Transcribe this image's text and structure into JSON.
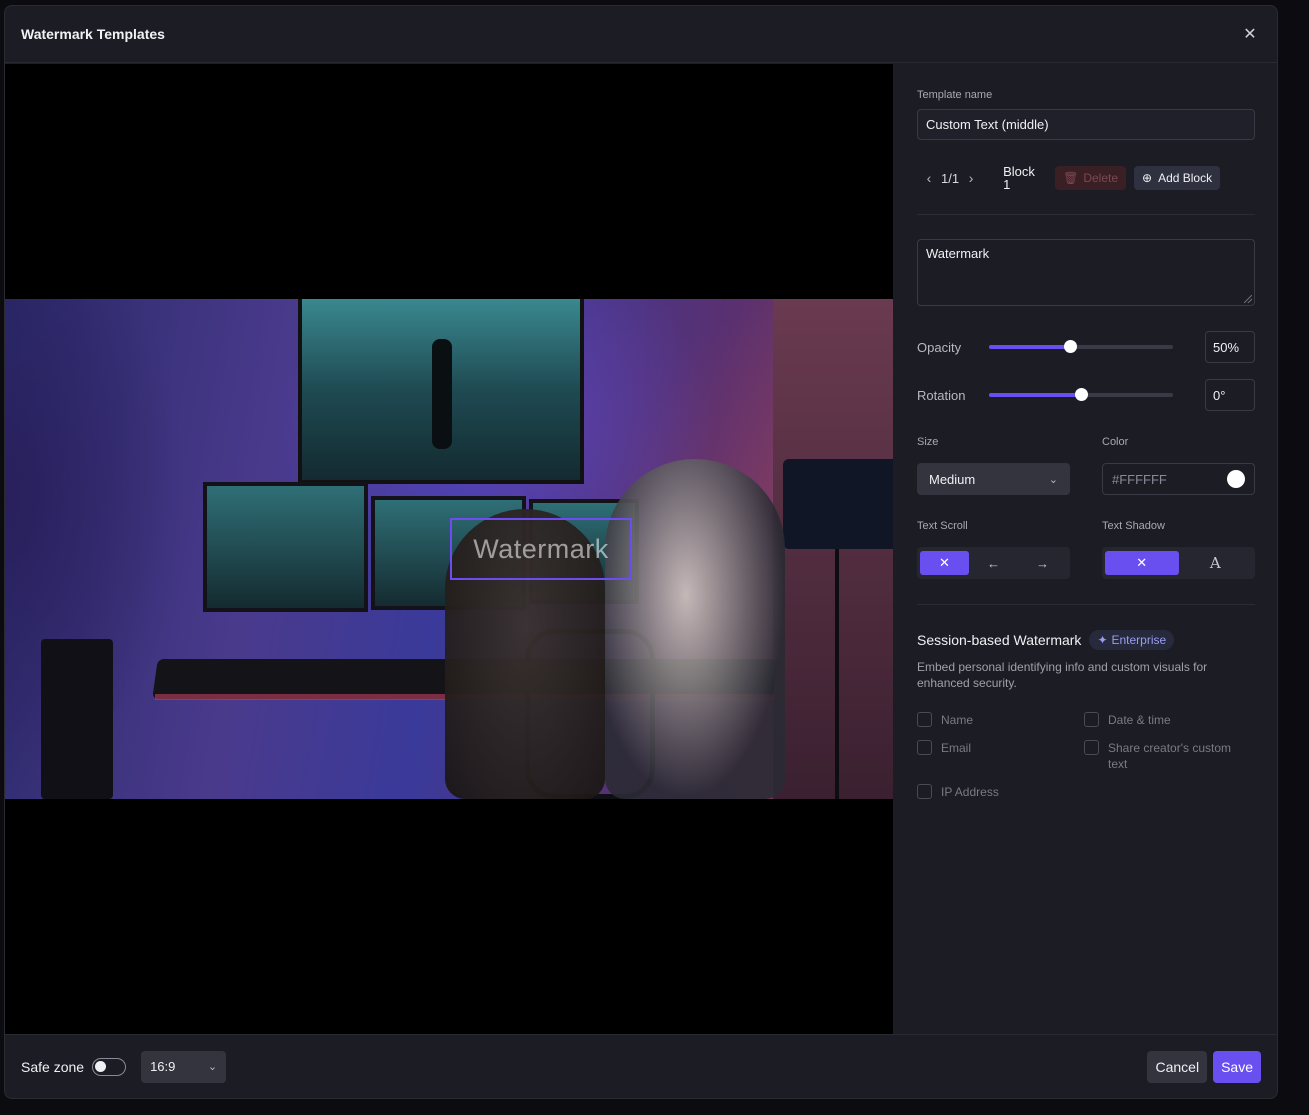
{
  "modal": {
    "title": "Watermark Templates"
  },
  "preview": {
    "watermark_text": "Watermark"
  },
  "settings": {
    "template_name_label": "Template name",
    "template_name_value": "Custom Text (middle)",
    "pager": "1/1",
    "block_label": "Block 1",
    "delete_label": "Delete",
    "add_block_label": "Add Block",
    "watermark_text": "Watermark",
    "opacity": {
      "label": "Opacity",
      "value": "50%",
      "fraction": 0.5
    },
    "rotation": {
      "label": "Rotation",
      "value": "0°",
      "fraction": 0.5
    },
    "size": {
      "label": "Size",
      "value": "Medium"
    },
    "color": {
      "label": "Color",
      "value": "#FFFFFF",
      "swatch": "#FFFFFF"
    },
    "text_scroll": {
      "label": "Text Scroll",
      "options": [
        "✕",
        "←",
        "→"
      ],
      "active_index": 0
    },
    "text_shadow": {
      "label": "Text Shadow",
      "options": [
        "✕",
        "A"
      ],
      "active_index": 0
    },
    "session": {
      "title": "Session-based Watermark",
      "badge": "Enterprise",
      "description": "Embed personal identifying info and custom visuals for enhanced security.",
      "options": [
        "Name",
        "Date & time",
        "Email",
        "Share creator's custom text",
        "IP Address"
      ]
    }
  },
  "footer": {
    "safe_zone_label": "Safe zone",
    "safe_zone_on": false,
    "aspect_ratio": "16:9",
    "cancel_label": "Cancel",
    "save_label": "Save"
  },
  "colors": {
    "accent": "#6A4FF0",
    "background": "#1C1C24",
    "preview_bg": "#000000"
  }
}
